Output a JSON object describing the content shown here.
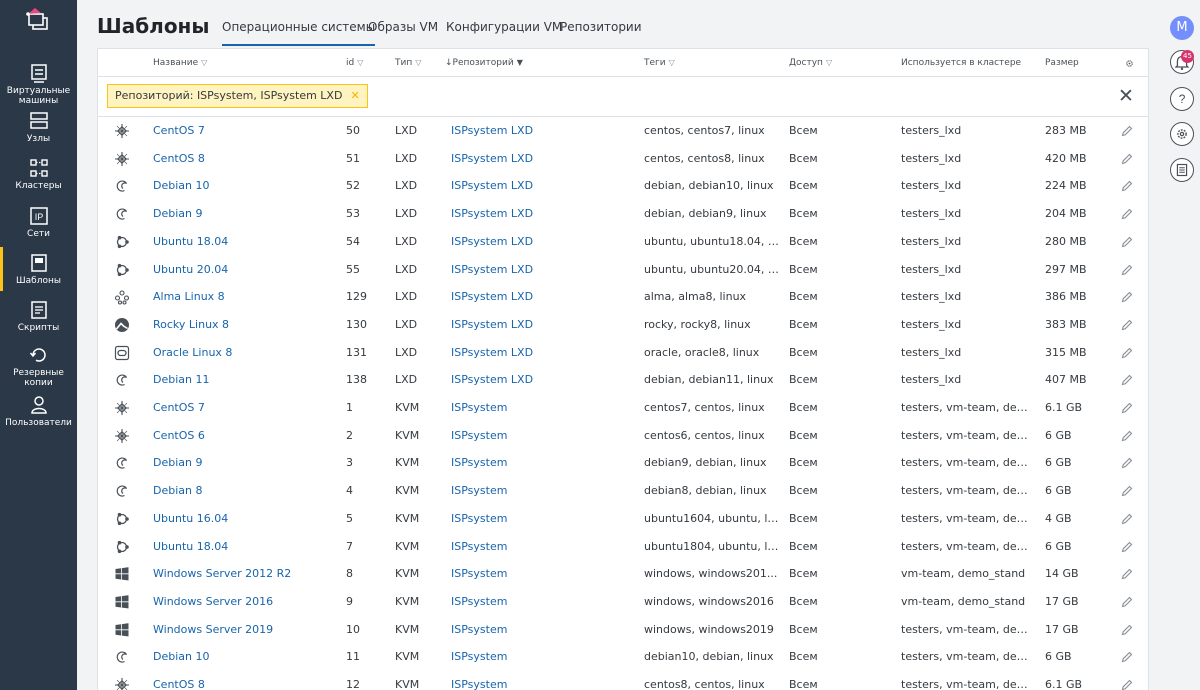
{
  "sidebar": {
    "items": [
      {
        "label": "Виртуальные машины",
        "icon": "vm-icon"
      },
      {
        "label": "Узлы",
        "icon": "nodes-icon"
      },
      {
        "label": "Кластеры",
        "icon": "clusters-icon"
      },
      {
        "label": "Сети",
        "icon": "ip-icon"
      },
      {
        "label": "Шаблоны",
        "icon": "templates-icon",
        "active": true
      },
      {
        "label": "Скрипты",
        "icon": "scripts-icon"
      },
      {
        "label": "Резервные копии",
        "icon": "backup-icon"
      },
      {
        "label": "Пользователи",
        "icon": "user-icon"
      }
    ]
  },
  "header": {
    "title": "Шаблоны",
    "tabs": [
      "Операционные системы",
      "Образы VM",
      "Конфигурации VM",
      "Репозитории"
    ]
  },
  "rail": {
    "avatar": "M",
    "notifications": "45"
  },
  "table": {
    "columns": {
      "name": "Название",
      "id": "id",
      "type": "Тип",
      "repo": "↓Репозиторий",
      "tags": "Теги",
      "access": "Доступ",
      "cluster": "Используется в кластере",
      "size": "Размер"
    },
    "filter_chip": "Репозиторий: ISPsystem, ISPsystem LXD",
    "rows": [
      {
        "icon": "centos",
        "name": "CentOS 7",
        "id": "50",
        "type": "LXD",
        "repo": "ISPsystem LXD",
        "tags": "centos, centos7, linux",
        "access": "Всем",
        "cluster": "testers_lxd",
        "size": "283 MB"
      },
      {
        "icon": "centos",
        "name": "CentOS 8",
        "id": "51",
        "type": "LXD",
        "repo": "ISPsystem LXD",
        "tags": "centos, centos8, linux",
        "access": "Всем",
        "cluster": "testers_lxd",
        "size": "420 MB"
      },
      {
        "icon": "debian",
        "name": "Debian 10",
        "id": "52",
        "type": "LXD",
        "repo": "ISPsystem LXD",
        "tags": "debian, debian10, linux",
        "access": "Всем",
        "cluster": "testers_lxd",
        "size": "224 MB"
      },
      {
        "icon": "debian",
        "name": "Debian 9",
        "id": "53",
        "type": "LXD",
        "repo": "ISPsystem LXD",
        "tags": "debian, debian9, linux",
        "access": "Всем",
        "cluster": "testers_lxd",
        "size": "204 MB"
      },
      {
        "icon": "ubuntu",
        "name": "Ubuntu 18.04",
        "id": "54",
        "type": "LXD",
        "repo": "ISPsystem LXD",
        "tags": "ubuntu, ubuntu18.04, li...",
        "access": "Всем",
        "cluster": "testers_lxd",
        "size": "280 MB"
      },
      {
        "icon": "ubuntu",
        "name": "Ubuntu 20.04",
        "id": "55",
        "type": "LXD",
        "repo": "ISPsystem LXD",
        "tags": "ubuntu, ubuntu20.04, li...",
        "access": "Всем",
        "cluster": "testers_lxd",
        "size": "297 MB"
      },
      {
        "icon": "alma",
        "name": "Alma Linux 8",
        "id": "129",
        "type": "LXD",
        "repo": "ISPsystem LXD",
        "tags": "alma, alma8, linux",
        "access": "Всем",
        "cluster": "testers_lxd",
        "size": "386 MB"
      },
      {
        "icon": "rocky",
        "name": "Rocky Linux 8",
        "id": "130",
        "type": "LXD",
        "repo": "ISPsystem LXD",
        "tags": "rocky, rocky8, linux",
        "access": "Всем",
        "cluster": "testers_lxd",
        "size": "383 MB"
      },
      {
        "icon": "oracle",
        "name": "Oracle Linux 8",
        "id": "131",
        "type": "LXD",
        "repo": "ISPsystem LXD",
        "tags": "oracle, oracle8, linux",
        "access": "Всем",
        "cluster": "testers_lxd",
        "size": "315 MB"
      },
      {
        "icon": "debian",
        "name": "Debian 11",
        "id": "138",
        "type": "LXD",
        "repo": "ISPsystem LXD",
        "tags": "debian, debian11, linux",
        "access": "Всем",
        "cluster": "testers_lxd",
        "size": "407 MB"
      },
      {
        "icon": "centos",
        "name": "CentOS 7",
        "id": "1",
        "type": "KVM",
        "repo": "ISPsystem",
        "tags": "centos7, centos, linux",
        "access": "Всем",
        "cluster": "testers, vm-team, dem...",
        "size": "6.1 GB"
      },
      {
        "icon": "centos",
        "name": "CentOS 6",
        "id": "2",
        "type": "KVM",
        "repo": "ISPsystem",
        "tags": "centos6, centos, linux",
        "access": "Всем",
        "cluster": "testers, vm-team, dem...",
        "size": "6 GB"
      },
      {
        "icon": "debian",
        "name": "Debian 9",
        "id": "3",
        "type": "KVM",
        "repo": "ISPsystem",
        "tags": "debian9, debian, linux",
        "access": "Всем",
        "cluster": "testers, vm-team, dem...",
        "size": "6 GB"
      },
      {
        "icon": "debian",
        "name": "Debian 8",
        "id": "4",
        "type": "KVM",
        "repo": "ISPsystem",
        "tags": "debian8, debian, linux",
        "access": "Всем",
        "cluster": "testers, vm-team, dem...",
        "size": "6 GB"
      },
      {
        "icon": "ubuntu",
        "name": "Ubuntu 16.04",
        "id": "5",
        "type": "KVM",
        "repo": "ISPsystem",
        "tags": "ubuntu1604, ubuntu, li...",
        "access": "Всем",
        "cluster": "testers, vm-team, dem...",
        "size": "4 GB"
      },
      {
        "icon": "ubuntu",
        "name": "Ubuntu 18.04",
        "id": "7",
        "type": "KVM",
        "repo": "ISPsystem",
        "tags": "ubuntu1804, ubuntu, li...",
        "access": "Всем",
        "cluster": "testers, vm-team, dem...",
        "size": "6 GB"
      },
      {
        "icon": "windows",
        "name": "Windows Server 2012 R2",
        "id": "8",
        "type": "KVM",
        "repo": "ISPsystem",
        "tags": "windows, windows201...",
        "access": "Всем",
        "cluster": "vm-team, demo_stand",
        "size": "14 GB"
      },
      {
        "icon": "windows",
        "name": "Windows Server 2016",
        "id": "9",
        "type": "KVM",
        "repo": "ISPsystem",
        "tags": "windows, windows2016",
        "access": "Всем",
        "cluster": "vm-team, demo_stand",
        "size": "17 GB"
      },
      {
        "icon": "windows",
        "name": "Windows Server 2019",
        "id": "10",
        "type": "KVM",
        "repo": "ISPsystem",
        "tags": "windows, windows2019",
        "access": "Всем",
        "cluster": "testers, vm-team, dem...",
        "size": "17 GB"
      },
      {
        "icon": "debian",
        "name": "Debian 10",
        "id": "11",
        "type": "KVM",
        "repo": "ISPsystem",
        "tags": "debian10, debian, linux",
        "access": "Всем",
        "cluster": "testers, vm-team, dem...",
        "size": "6 GB"
      },
      {
        "icon": "centos",
        "name": "CentOS 8",
        "id": "12",
        "type": "KVM",
        "repo": "ISPsystem",
        "tags": "centos8, centos, linux",
        "access": "Всем",
        "cluster": "testers, vm-team, dem...",
        "size": "6.1 GB"
      }
    ]
  }
}
